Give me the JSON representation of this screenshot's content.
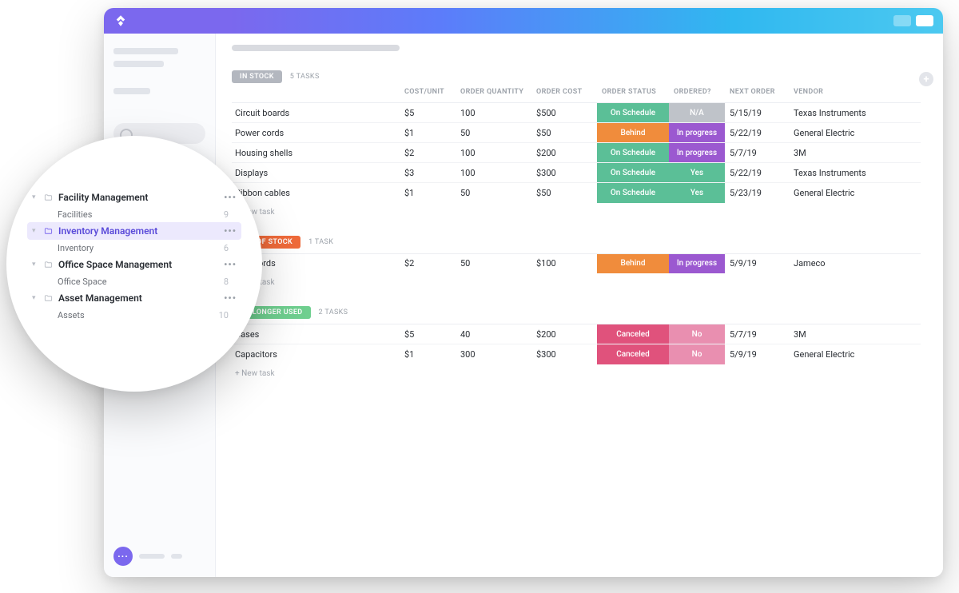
{
  "misc": {
    "new_task": "+ New task",
    "add_icon": "+",
    "chat_icon": "···"
  },
  "columns": {
    "name": "",
    "cost_unit": "COST/UNIT",
    "order_qty": "ORDER QUANTITY",
    "order_cost": "ORDER COST",
    "order_status": "ORDER STATUS",
    "ordered": "ORDERED?",
    "next_order": "NEXT ORDER",
    "vendor": "VENDOR"
  },
  "status_colors": {
    "On Schedule": "#5bbf97",
    "Behind": "#f08c3c",
    "In progress": "#9b59d0",
    "Yes": "#5bbf97",
    "N/A": "#bfc3c9",
    "Canceled": "#e0527c",
    "No": "#e98fb0"
  },
  "groups": [
    {
      "label": "IN STOCK",
      "color": "#b3b7bf",
      "count_label": "5 TASKS",
      "rows": [
        {
          "name": "Circuit boards",
          "cost_unit": "$5",
          "qty": "100",
          "order_cost": "$500",
          "status": "On Schedule",
          "ordered": "N/A",
          "next": "5/15/19",
          "vendor": "Texas Instruments"
        },
        {
          "name": "Power cords",
          "cost_unit": "$1",
          "qty": "50",
          "order_cost": "$50",
          "status": "Behind",
          "ordered": "In progress",
          "next": "5/22/19",
          "vendor": "General Electric"
        },
        {
          "name": "Housing shells",
          "cost_unit": "$2",
          "qty": "100",
          "order_cost": "$200",
          "status": "On Schedule",
          "ordered": "In progress",
          "next": "5/7/19",
          "vendor": "3M"
        },
        {
          "name": "Displays",
          "cost_unit": "$3",
          "qty": "100",
          "order_cost": "$300",
          "status": "On Schedule",
          "ordered": "Yes",
          "next": "5/22/19",
          "vendor": "Texas Instruments"
        },
        {
          "name": "Ribbon cables",
          "cost_unit": "$1",
          "qty": "50",
          "order_cost": "$50",
          "status": "On Schedule",
          "ordered": "Yes",
          "next": "5/23/19",
          "vendor": "General Electric"
        }
      ]
    },
    {
      "label": "OUT OF STOCK",
      "color": "#ef6a3a",
      "count_label": "1 TASK",
      "rows": [
        {
          "name": "USB cords",
          "cost_unit": "$2",
          "qty": "50",
          "order_cost": "$100",
          "status": "Behind",
          "ordered": "In progress",
          "next": "5/9/19",
          "vendor": "Jameco"
        }
      ]
    },
    {
      "label": "NO LONGER USED",
      "color": "#6fcf8f",
      "count_label": "2 TASKS",
      "rows": [
        {
          "name": "Cases",
          "cost_unit": "$5",
          "qty": "40",
          "order_cost": "$200",
          "status": "Canceled",
          "ordered": "No",
          "next": "5/7/19",
          "vendor": "3M"
        },
        {
          "name": "Capacitors",
          "cost_unit": "$1",
          "qty": "300",
          "order_cost": "$300",
          "status": "Canceled",
          "ordered": "No",
          "next": "5/9/19",
          "vendor": "General Electric"
        }
      ]
    }
  ],
  "sidebar_tree": [
    {
      "label": "Facility Management",
      "selected": false,
      "children": [
        {
          "label": "Facilities",
          "count": "9"
        }
      ]
    },
    {
      "label": "Inventory Management",
      "selected": true,
      "children": [
        {
          "label": "Inventory",
          "count": "6"
        }
      ]
    },
    {
      "label": "Office Space Management",
      "selected": false,
      "children": [
        {
          "label": "Office Space",
          "count": "8"
        }
      ]
    },
    {
      "label": "Asset Management",
      "selected": false,
      "children": [
        {
          "label": "Assets",
          "count": "10"
        }
      ]
    }
  ]
}
